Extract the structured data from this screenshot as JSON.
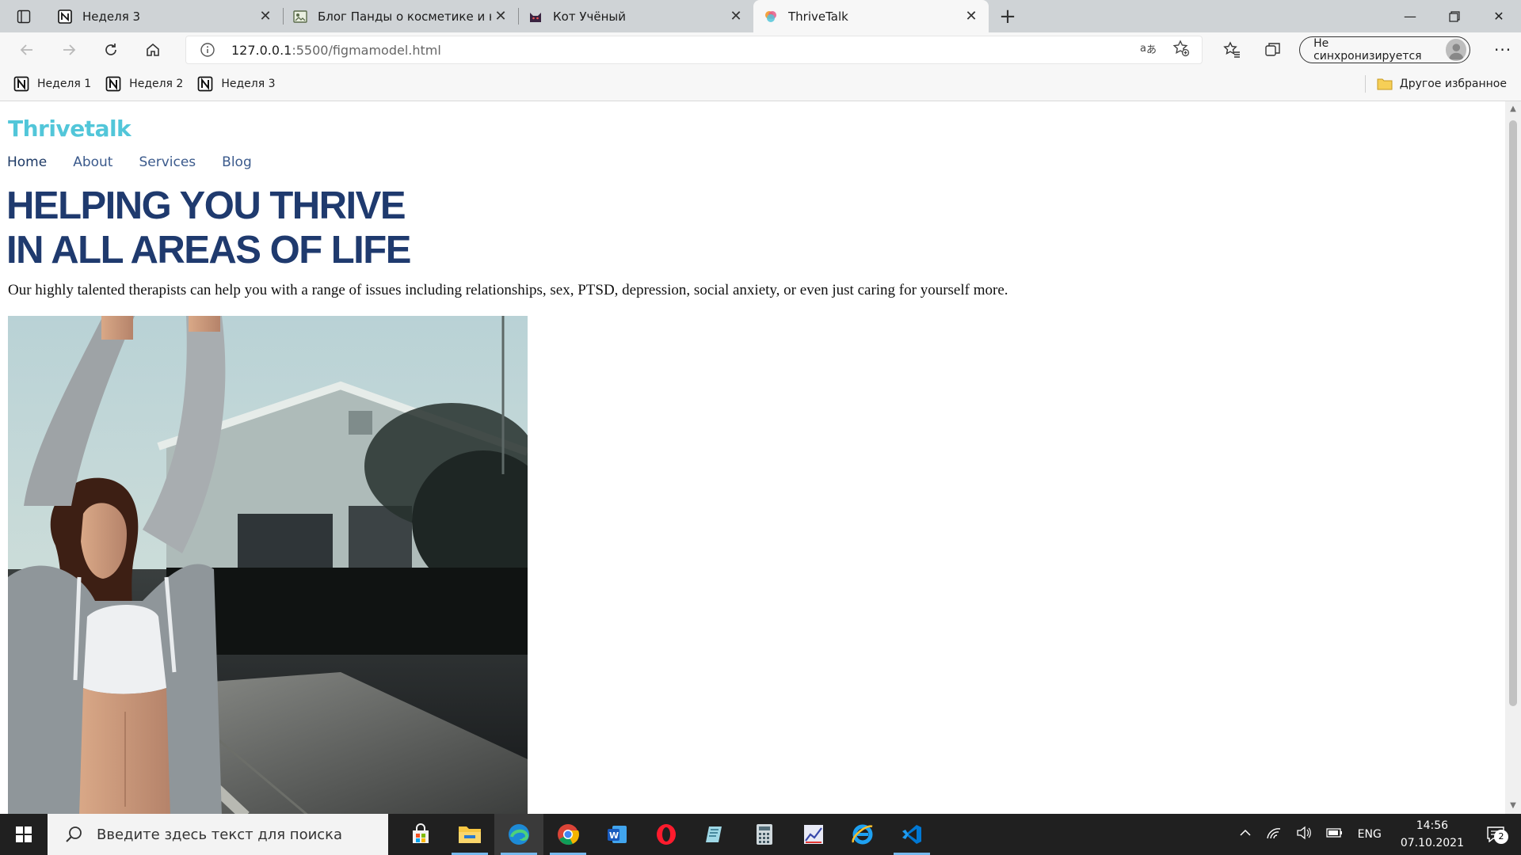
{
  "tabs": [
    {
      "title": "Неделя 3",
      "icon": "notion-icon",
      "active": false
    },
    {
      "title": "Блог Панды о косметике и не т",
      "icon": "blog-icon",
      "active": false
    },
    {
      "title": "Кот Учёный",
      "icon": "cat-icon",
      "active": false
    },
    {
      "title": "ThriveTalk",
      "icon": "thrivetalk-icon",
      "active": true
    }
  ],
  "address": {
    "host": "127.0.0.1",
    "path": ":5500/figmamodel.html"
  },
  "profile": {
    "label": "Не синхронизируется"
  },
  "favorites": [
    {
      "label": "Неделя 1"
    },
    {
      "label": "Неделя 2"
    },
    {
      "label": "Неделя 3"
    }
  ],
  "favorites_other": {
    "label": "Другое избранное"
  },
  "page": {
    "logo": "Thrivetalk",
    "nav": [
      {
        "label": "Home"
      },
      {
        "label": "About"
      },
      {
        "label": "Services"
      },
      {
        "label": "Blog"
      }
    ],
    "hero_line1": "HELPING YOU THRIVE",
    "hero_line2": "IN ALL AREAS OF LIFE",
    "hero_text": "Our highly talented therapists can help you with a range of issues including relationships, sex, PTSD, depression, social anxiety, or even just caring for yourself more."
  },
  "taskbar": {
    "search_placeholder": "Введите здесь текст для поиска",
    "language": "ENG",
    "time": "14:56",
    "date": "07.10.2021",
    "notifications": "2"
  },
  "colors": {
    "logo": "#52c6d9",
    "heading": "#1f3a6e",
    "nav_link": "#3b5a8c",
    "tabstrip": "#cfd3d6",
    "taskbar": "#202020"
  }
}
